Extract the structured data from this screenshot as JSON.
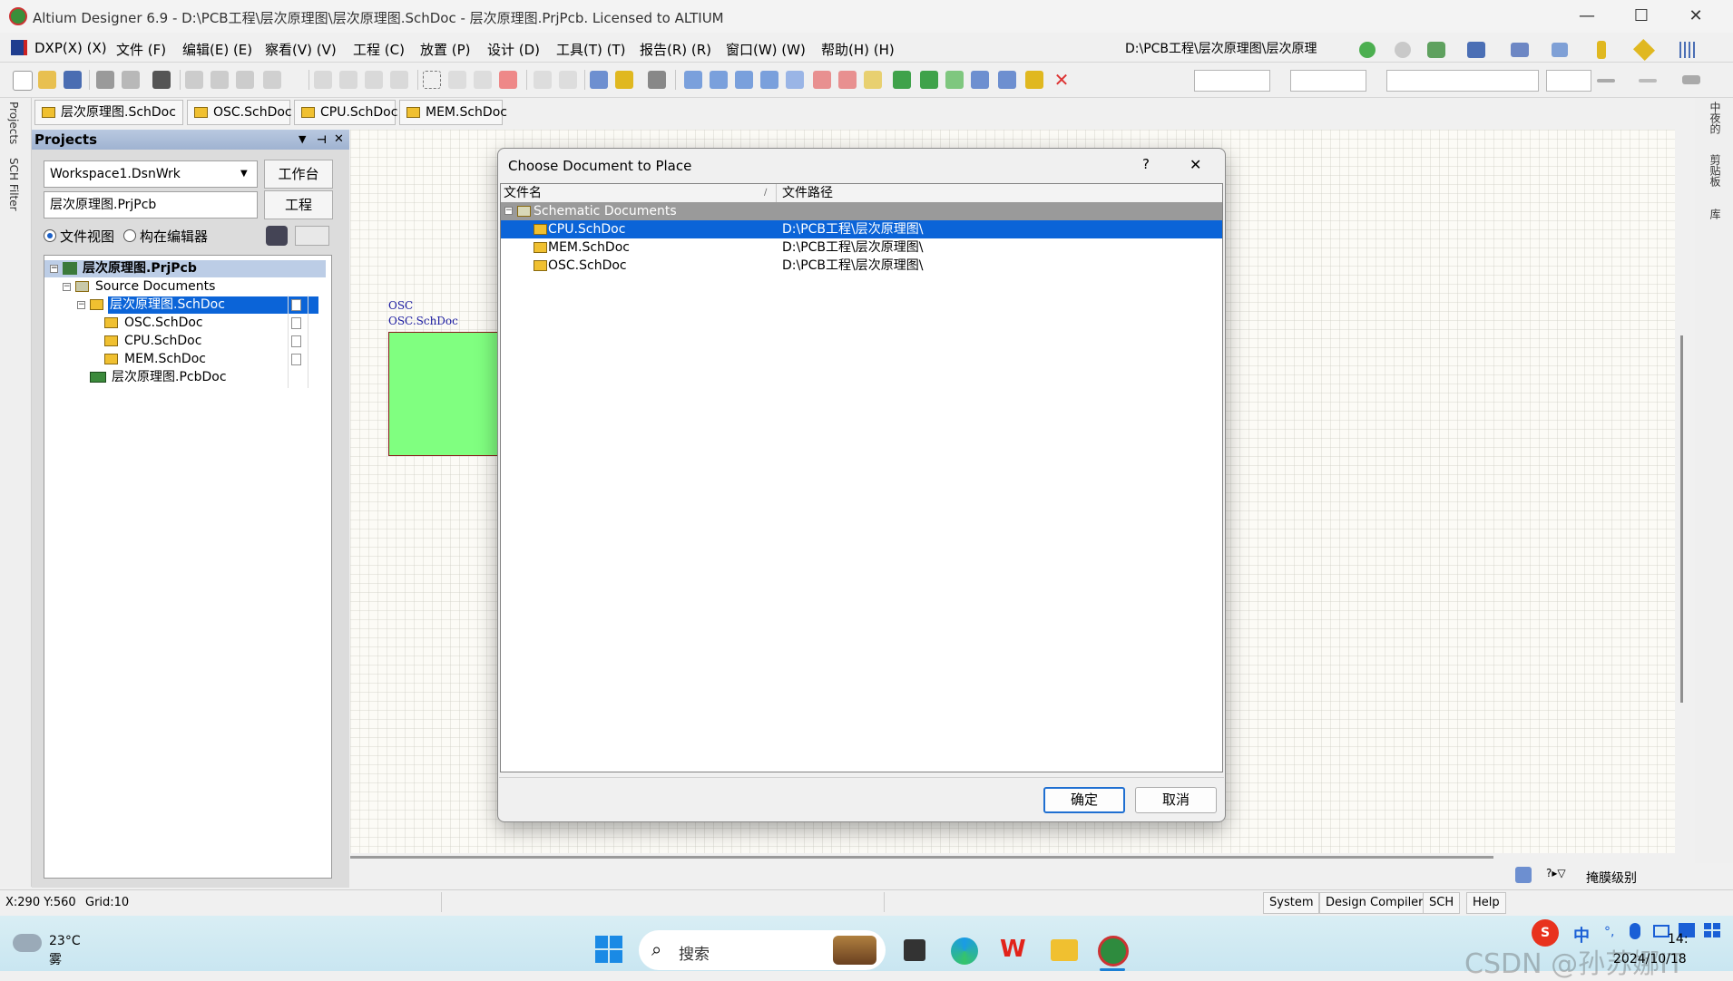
{
  "window": {
    "title": "Altium Designer 6.9 - D:\\PCB工程\\层次原理图\\层次原理图.SchDoc - 层次原理图.PrjPcb. Licensed to ALTIUM",
    "minimize": "—",
    "maximize": "☐",
    "close": "✕"
  },
  "menu": {
    "items": [
      "DXP(X) (X)",
      "文件 (F)",
      "编辑(E) (E)",
      "察看(V) (V)",
      "工程 (C)",
      "放置 (P)",
      "设计 (D)",
      "工具(T) (T)",
      "报告(R) (R)",
      "窗口(W) (W)",
      "帮助(H) (H)"
    ],
    "path_combo": "D:\\PCB工程\\层次原理图\\层次原理"
  },
  "doc_tabs": [
    "层次原理图.SchDoc",
    "OSC.SchDoc",
    "CPU.SchDoc",
    "MEM.SchDoc"
  ],
  "left_strip": {
    "projects": "Projects",
    "sch_filter": "SCH Filter"
  },
  "projects_panel": {
    "title": "Projects",
    "workspace": "Workspace1.DsnWrk",
    "workspace_btn": "工作台",
    "project": "层次原理图.PrjPcb",
    "project_btn": "工程",
    "radio_file_view": "文件视图",
    "radio_struct_editor": "构在编辑器",
    "tree": {
      "project": "层次原理图.PrjPcb",
      "source_docs": "Source Documents",
      "top_sheet": "层次原理图.SchDoc",
      "children": [
        "OSC.SchDoc",
        "CPU.SchDoc",
        "MEM.SchDoc"
      ],
      "pcb": "层次原理图.PcbDoc"
    }
  },
  "canvas": {
    "sheet_symbol_designator": "OSC",
    "sheet_symbol_filename": "OSC.SchDoc",
    "sheet_color": "#80ff80"
  },
  "dialog": {
    "title": "Choose Document to Place",
    "help": "?",
    "close": "✕",
    "col_name": "文件名",
    "col_path": "文件路径",
    "group": "Schematic Documents",
    "rows": [
      {
        "name": "CPU.SchDoc",
        "path": "D:\\PCB工程\\层次原理图\\",
        "selected": true
      },
      {
        "name": "MEM.SchDoc",
        "path": "D:\\PCB工程\\层次原理图\\",
        "selected": false
      },
      {
        "name": "OSC.SchDoc",
        "path": "D:\\PCB工程\\层次原理图\\",
        "selected": false
      }
    ],
    "ok": "确定",
    "cancel": "取消"
  },
  "status": {
    "coords": "X:290 Y:560",
    "grid": "Grid:10",
    "tabs": [
      "System",
      "Design Compiler",
      "SCH",
      "Help"
    ],
    "mask_level": "掩膜级别"
  },
  "right_strip": [
    "中夜的",
    "剪贴板",
    "库"
  ],
  "taskbar": {
    "weather_temp": "23°C",
    "weather_desc": "雾",
    "search_placeholder": "搜索",
    "ime": "中",
    "time": "14:",
    "date": "2024/10/18",
    "watermark": "CSDN @孙苏娜IT"
  },
  "colors": {
    "selection": "#0b64d8",
    "panel_header": "#9fb3d1",
    "taskbar": "#cfe9f2"
  }
}
